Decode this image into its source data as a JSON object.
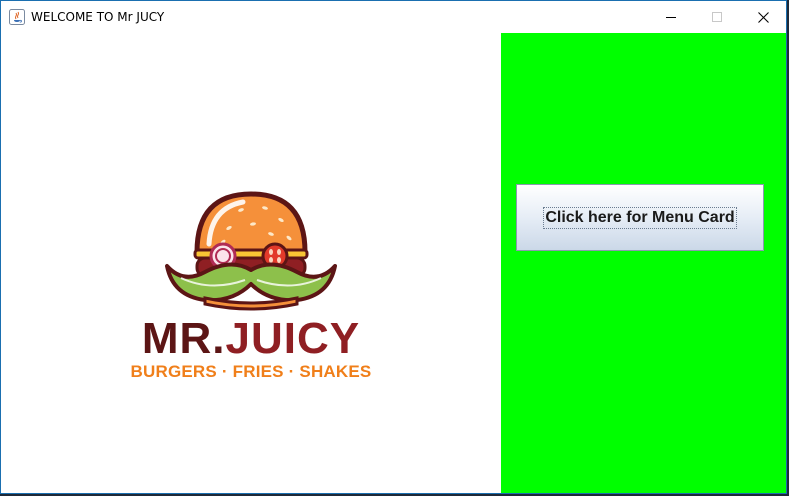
{
  "window": {
    "title": "WELCOME TO Mr JUCY",
    "app_icon": "java-coffee-icon",
    "controls": [
      "minimize-icon",
      "maximize-icon",
      "close-icon"
    ]
  },
  "logo": {
    "brand_first": "MR.",
    "brand_second": "JUICY",
    "tagline": "BURGERS · FRIES · SHAKES",
    "icon": "burger-mustache-icon"
  },
  "right_panel": {
    "background": "#00ff00",
    "button_label": "Click here for Menu Card"
  },
  "colors": {
    "brand_dark": "#5c1515",
    "brand_red": "#8f1f23",
    "tagline_orange": "#f07f1a",
    "panel_green": "#00ff00"
  }
}
